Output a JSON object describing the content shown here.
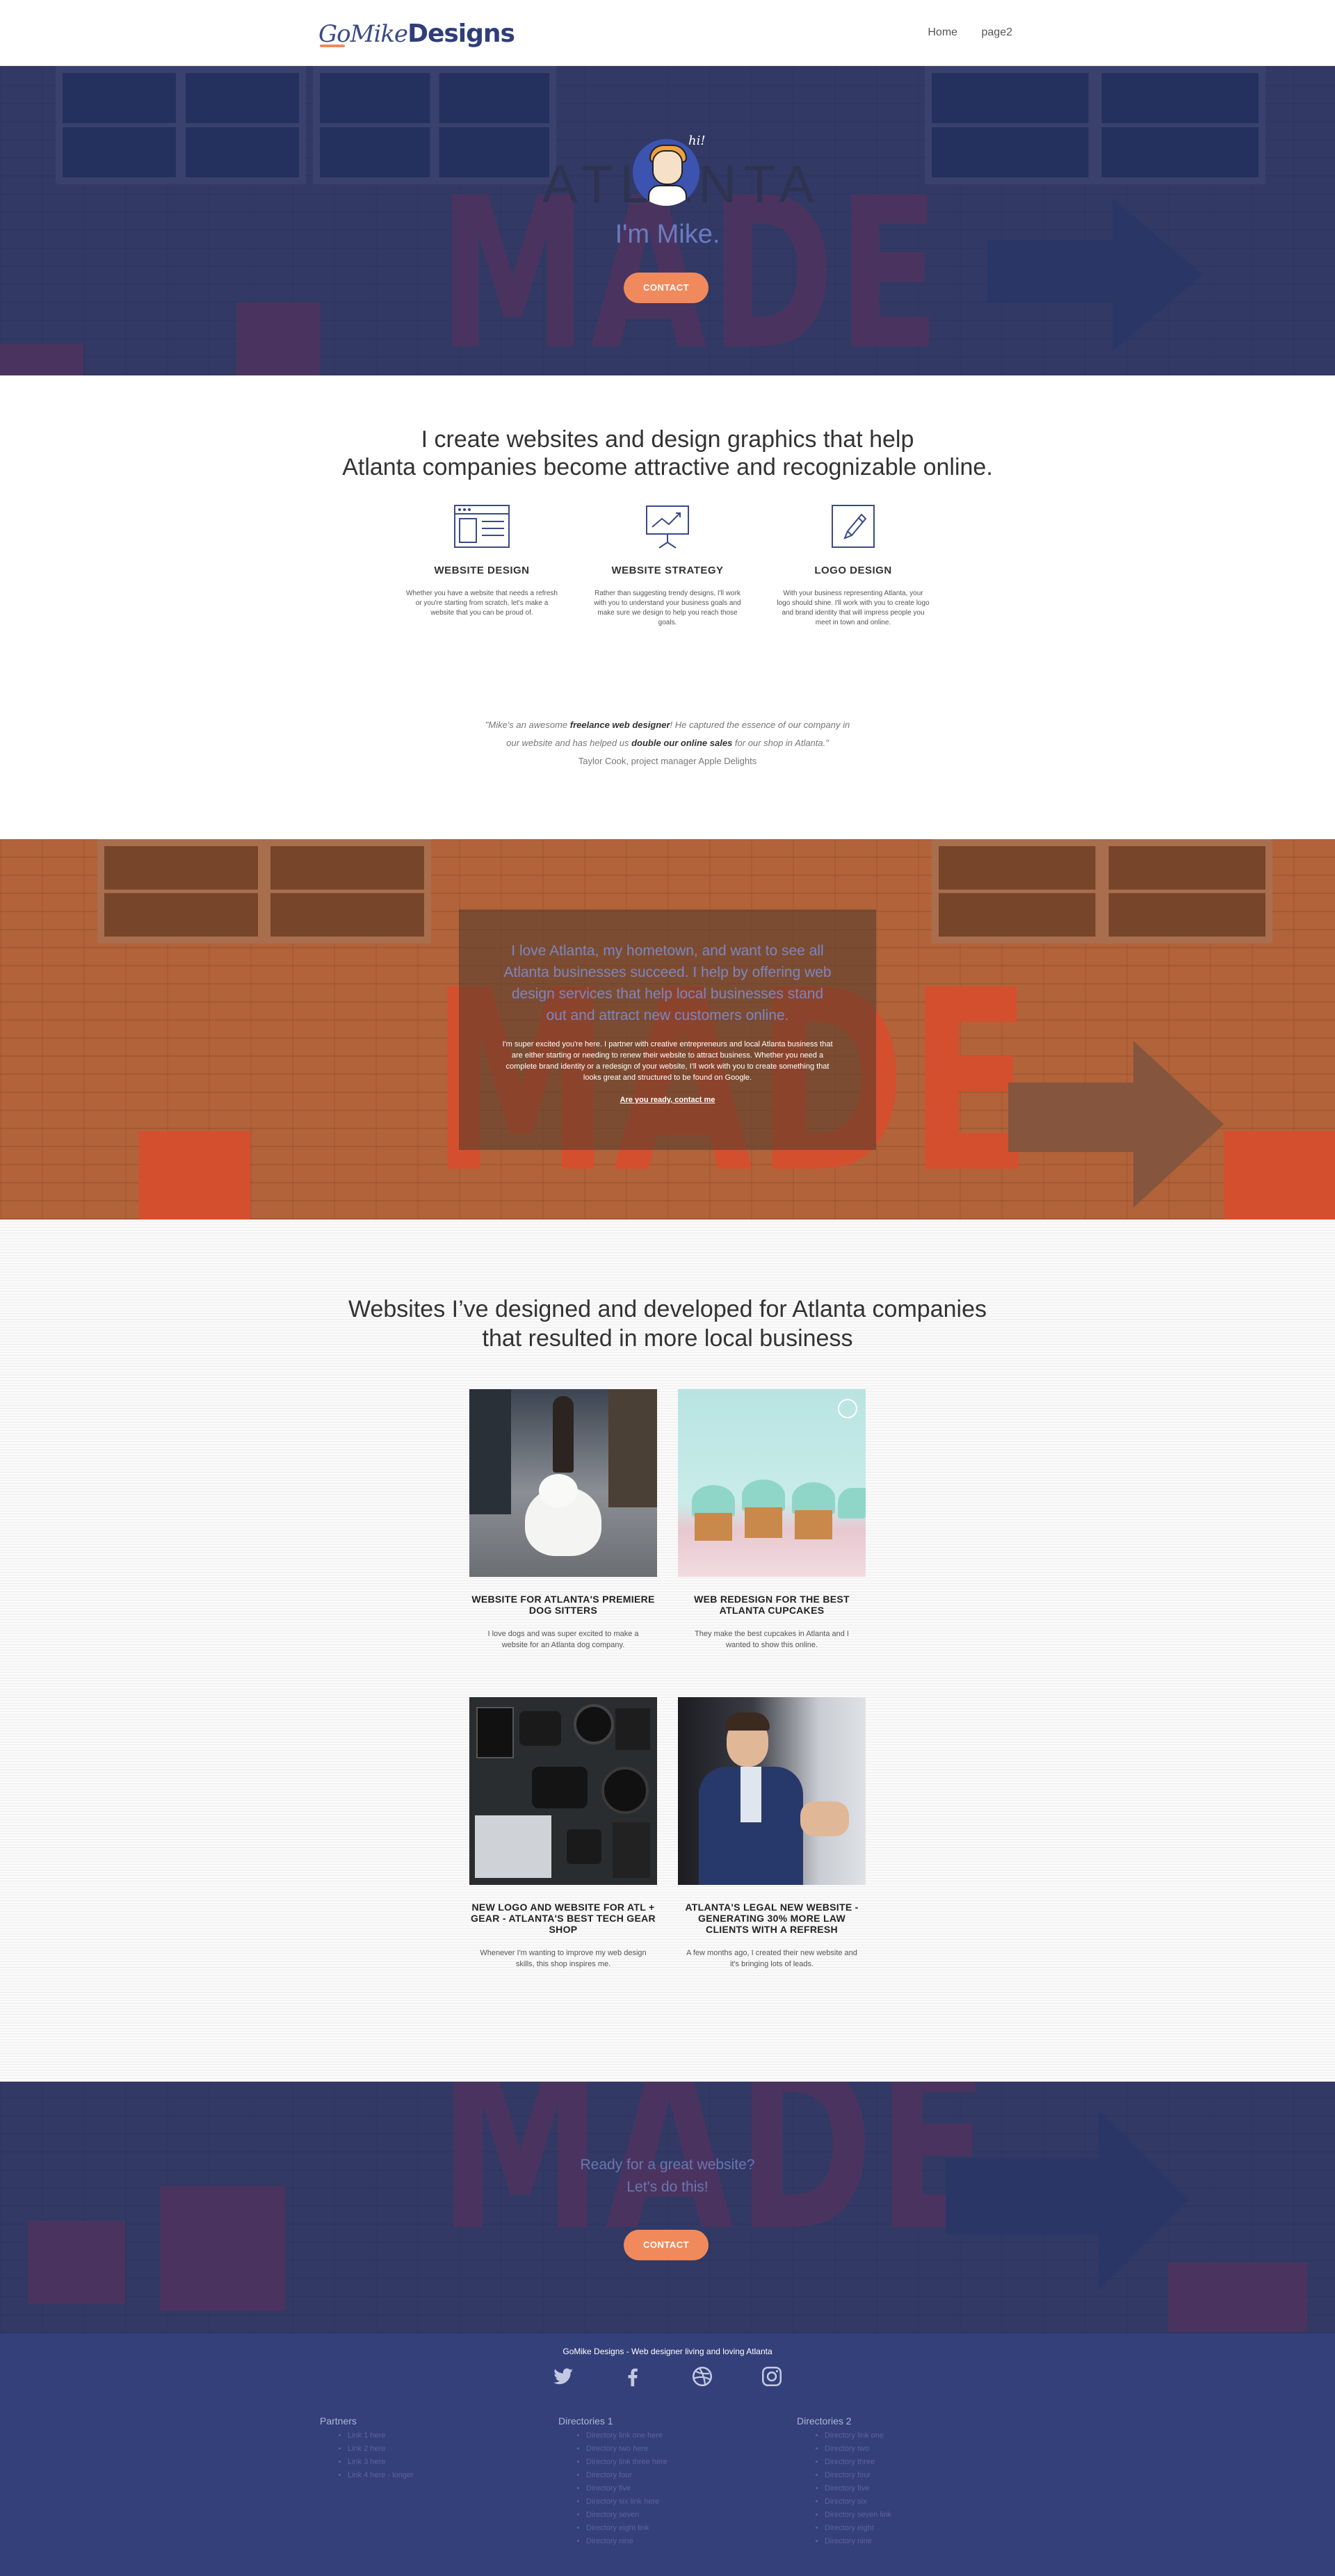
{
  "nav": {
    "logo_go": "Go",
    "logo_mike": "Mike",
    "logo_designs": "Designs",
    "links": [
      "Home",
      "page2"
    ]
  },
  "hero": {
    "sign_text": "ATLANTA",
    "made_text": "MADE",
    "bubble": "hi!",
    "title": "I'm Mike.",
    "button": "CONTACT"
  },
  "services": {
    "heading_line1": "I create websites and design graphics that help",
    "heading_line2": "Atlanta companies become attractive and recognizable online.",
    "items": [
      {
        "icon": "browser-window-icon",
        "title": "WEBSITE DESIGN",
        "text": "Whether you have a website that needs a refresh or you're starting from scratch, let's make a website that you can be proud of."
      },
      {
        "icon": "presentation-chart-icon",
        "title": "WEBSITE STRATEGY",
        "text": "Rather than suggesting trendy designs, I'll work with you to understand your business goals and make sure we design to help you reach those goals."
      },
      {
        "icon": "pencil-icon",
        "title": "LOGO DESIGN",
        "text": "With your business representing Atlanta, your logo should shine. I'll work with you to create logo and brand identity that will impress people you meet in town and online."
      }
    ]
  },
  "testimonial": {
    "part1": "\"Mike's an awesome ",
    "bold1": "freelance web designer",
    "part2": "! He captured the essence of our company in our website and has helped us ",
    "bold2": "double our online sales",
    "part3": " for our shop in Atlanta.\"",
    "cite": "Taylor Cook, project manager Apple Delights"
  },
  "about": {
    "lead": "I love Atlanta, my hometown, and want to see all Atlanta businesses succeed. I help by offering web design services that help local businesses stand out and attract new customers online.",
    "body": "I'm super excited you're here. I partner with creative entrepreneurs and local Atlanta business that are either starting or needing to renew their website to attract business. Whether you need a complete brand identity or a redesign of your website, I'll work with you to create something that looks great and structured to be found on Google.",
    "cta": "Are you ready, contact me"
  },
  "portfolio": {
    "heading_line1": "Websites I’ve designed and developed for Atlanta companies",
    "heading_line2": "that resulted in more local business",
    "cards": [
      {
        "title": "WEBSITE FOR ATLANTA'S PREMIERE DOG SITTERS",
        "text": "I love dogs and was super excited to make a website for an Atlanta dog company."
      },
      {
        "title": "WEB REDESIGN FOR THE BEST ATLANTA CUPCAKES",
        "text": "They make the best cupcakes in Atlanta and I wanted to show this online."
      },
      {
        "title": "NEW LOGO AND WEBSITE FOR ATL + GEAR - ATLANTA'S BEST TECH GEAR SHOP",
        "text": "Whenever I'm wanting to improve my web design skills, this shop inspires me."
      },
      {
        "title": "ATLANTA'S LEGAL NEW WEBSITE - GENERATING 30% MORE LAW CLIENTS WITH A REFRESH",
        "text": "A few months ago, I created their new website and it's bringing lots of leads."
      }
    ]
  },
  "cta": {
    "line1": "Ready for a great website?",
    "line2": "Let's do this!",
    "button": "CONTACT"
  },
  "footer": {
    "tagline": "GoMike Designs - Web designer living and loving Atlanta",
    "social": [
      "twitter-icon",
      "facebook-icon",
      "dribbble-icon",
      "instagram-icon"
    ],
    "columns": [
      {
        "title": "Partners",
        "items": [
          "Link 1 here",
          "Link 2 here",
          "Link 3 here",
          "Link 4 here - longer"
        ]
      },
      {
        "title": "Directories 1",
        "items": [
          "Directory link one here",
          "Directory two here",
          "Directory link three here",
          "Directory four",
          "Directory five",
          "Directory six link here",
          "Directory seven",
          "Directory eight link",
          "Directory nine"
        ]
      },
      {
        "title": "Directories 2",
        "items": [
          "Directory link one",
          "Directory two",
          "Directory three",
          "Directory four",
          "Directory five",
          "Directory six",
          "Directory seven link",
          "Directory eight",
          "Directory nine"
        ]
      }
    ]
  },
  "colors": {
    "accent": "#f08a5d",
    "navy": "#34407a",
    "brand_blue": "#3a4a87"
  }
}
